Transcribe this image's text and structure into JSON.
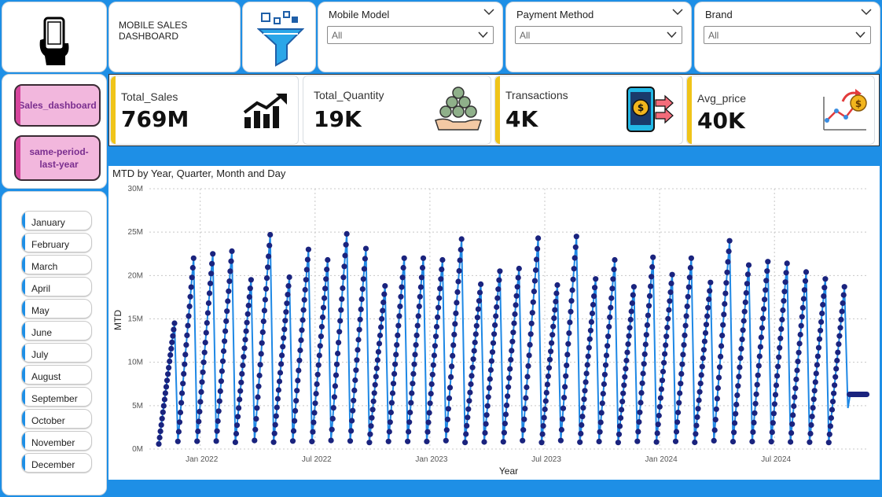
{
  "header": {
    "title": "MOBILE SALES DASHBOARD"
  },
  "icons": {
    "logo": "hand-holding-phone-icon",
    "filter": "funnel-icon"
  },
  "slicers": [
    {
      "title": "Mobile Model",
      "value": "All"
    },
    {
      "title": "Payment Method",
      "value": "All"
    },
    {
      "title": "Brand",
      "value": "All"
    }
  ],
  "nav": {
    "buttons": [
      "Sales_dashboard",
      "same-period-last-year"
    ]
  },
  "kpis": [
    {
      "label": "Total_Sales",
      "value": "769M",
      "icon": "rising-bar-chart-icon"
    },
    {
      "label": "Total_Quantity",
      "value": "19K",
      "icon": "money-stack-hand-icon"
    },
    {
      "label": "Transactions",
      "value": "4K",
      "icon": "phone-payment-icon"
    },
    {
      "label": "Avg_price",
      "value": "40K",
      "icon": "price-growth-icon"
    }
  ],
  "months": [
    "January",
    "February",
    "March",
    "April",
    "May",
    "June",
    "July",
    "August",
    "September",
    "October",
    "November",
    "December"
  ],
  "colors": {
    "accent": "#1e8fe6",
    "nav_fill": "#f2b7dd",
    "nav_text": "#7a2e8f",
    "kpi_bar": "#f0c419",
    "line": "#1e88e5",
    "marker": "#1a237e"
  },
  "chart_data": {
    "type": "line",
    "title": "MTD by Year, Quarter, Month and Day",
    "xlabel": "Year",
    "ylabel": "MTD",
    "ylim": [
      0,
      30000000
    ],
    "y_ticks": [
      "0M",
      "5M",
      "10M",
      "15M",
      "20M",
      "25M",
      "30M"
    ],
    "x_ticks": [
      "Jan 2022",
      "Jul 2022",
      "Jan 2023",
      "Jul 2023",
      "Jan 2024",
      "Jul 2024"
    ],
    "grid": true,
    "series": [
      {
        "x_months": [
          "Nov 2021",
          "Dec 2021",
          "Jan 2022",
          "Feb 2022",
          "Mar 2022",
          "Apr 2022",
          "May 2022",
          "Jun 2022",
          "Jul 2022",
          "Aug 2022",
          "Sep 2022",
          "Oct 2022",
          "Nov 2022",
          "Dec 2022",
          "Jan 2023",
          "Feb 2023",
          "Mar 2023",
          "Apr 2023",
          "May 2023",
          "Jun 2023",
          "Jul 2023",
          "Aug 2023",
          "Sep 2023",
          "Oct 2023",
          "Nov 2023",
          "Dec 2023",
          "Jan 2024",
          "Feb 2024",
          "Mar 2024",
          "Apr 2024",
          "May 2024",
          "Jun 2024",
          "Jul 2024",
          "Aug 2024",
          "Sep 2024",
          "Oct 2024"
        ],
        "month_end_mtd": [
          14500000,
          22000000,
          22500000,
          22800000,
          19500000,
          24700000,
          19800000,
          23000000,
          21800000,
          24800000,
          23100000,
          18800000,
          22000000,
          22000000,
          21800000,
          24200000,
          19000000,
          20500000,
          20800000,
          24300000,
          18900000,
          24500000,
          19600000,
          21800000,
          18700000,
          22100000,
          20100000,
          22000000,
          19200000,
          24000000,
          21200000,
          21600000,
          21400000,
          20400000,
          19600000,
          18700000
        ],
        "partial_month": {
          "month": "Nov 2024",
          "mtd": 6300000
        }
      }
    ]
  }
}
